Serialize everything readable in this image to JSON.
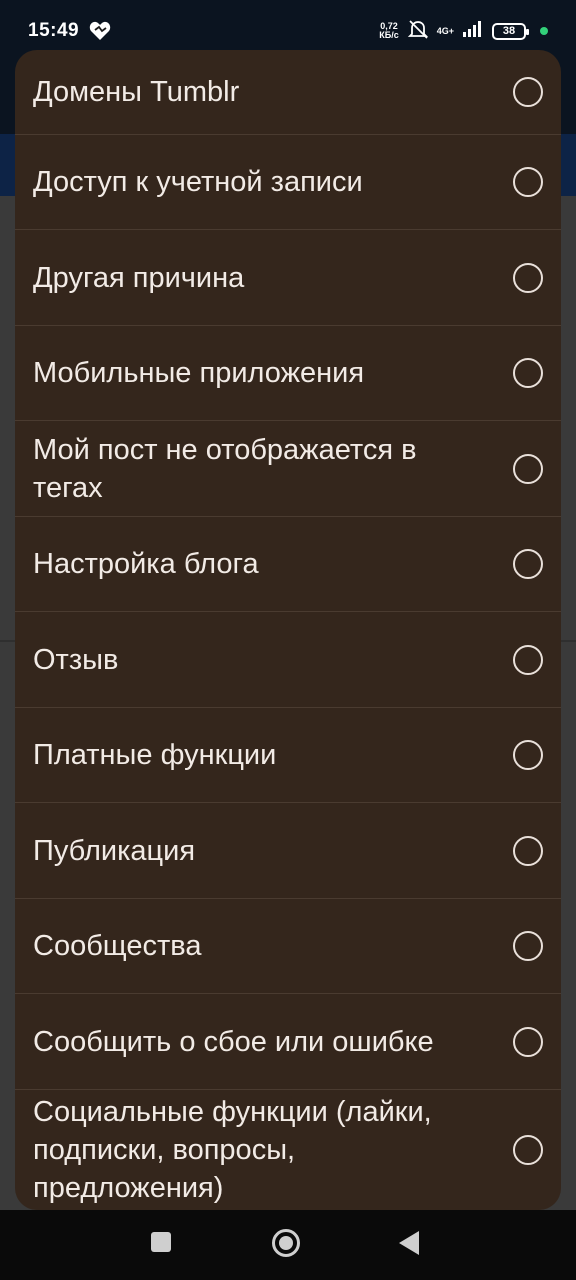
{
  "status_bar": {
    "time": "15:49",
    "net_speed_value": "0,72",
    "net_speed_unit": "КБ/с",
    "signal_label": "4G+",
    "battery": "38"
  },
  "dialog": {
    "options": [
      {
        "label": "Домены Tumblr",
        "selected": false
      },
      {
        "label": "Доступ к учетной записи",
        "selected": false
      },
      {
        "label": "Другая причина",
        "selected": false
      },
      {
        "label": "Мобильные приложения",
        "selected": false
      },
      {
        "label": "Мой пост не отображается в тегах",
        "selected": false
      },
      {
        "label": "Настройка блога",
        "selected": false
      },
      {
        "label": "Отзыв",
        "selected": false
      },
      {
        "label": "Платные функции",
        "selected": false
      },
      {
        "label": "Публикация",
        "selected": false
      },
      {
        "label": "Сообщества",
        "selected": false
      },
      {
        "label": "Сообщить о сбое или ошибке",
        "selected": false
      },
      {
        "label": "Социальные функции (лайки, подписки, вопросы, предложения)",
        "selected": false
      }
    ]
  },
  "colors": {
    "dialog_bg": "#34261c",
    "divider": "#4a3b30",
    "text": "#f2ebe6",
    "radio": "#e9e0da"
  },
  "icons": [
    "heart-icon",
    "mute-icon",
    "signal-icon",
    "battery-icon",
    "nav-recents-icon",
    "nav-home-icon",
    "nav-back-icon"
  ]
}
